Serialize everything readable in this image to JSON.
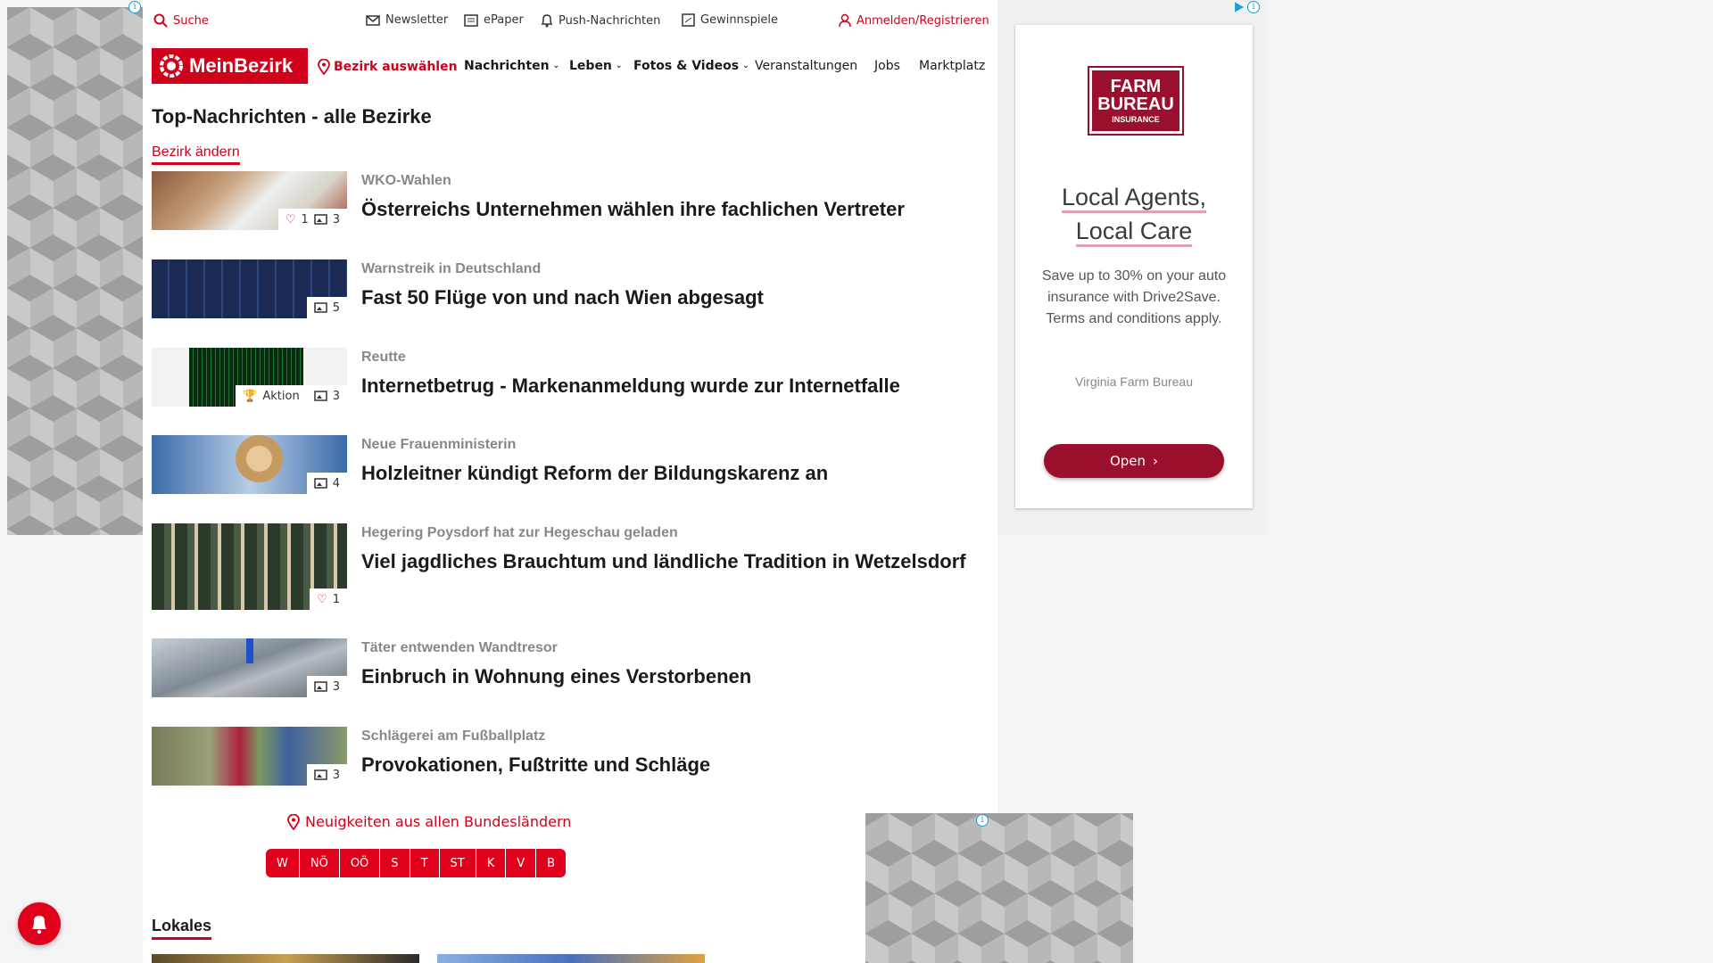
{
  "utility_bar": {
    "search": "Suche",
    "newsletter": "Newsletter",
    "epaper": "ePaper",
    "push": "Push-Nachrichten",
    "gewinnspiele": "Gewinnspiele",
    "login": "Anmelden/Registrieren"
  },
  "nav": {
    "logo": "MeinBezirk",
    "bezirk_auswaehlen": "Bezirk auswählen",
    "links": [
      "Nachrichten",
      "Leben",
      "Fotos & Videos",
      "Veranstaltungen",
      "Jobs",
      "Marktplatz"
    ]
  },
  "page": {
    "title": "Top-Nachrichten - alle Bezirke",
    "bezirk_aendern": "Bezirk ändern"
  },
  "articles": [
    {
      "kicker": "WKO-Wahlen",
      "headline": "Österreichs Unternehmen wählen ihre fachlichen Vertreter",
      "likes": "1",
      "images": "3"
    },
    {
      "kicker": "Warnstreik in Deutschland",
      "headline": "Fast 50 Flüge von und nach Wien abgesagt",
      "images": "5"
    },
    {
      "kicker": "Reutte",
      "headline": "Internetbetrug - Markenanmeldung wurde zur Internetfalle",
      "tag": "Aktion",
      "images": "3"
    },
    {
      "kicker": "Neue Frauenministerin",
      "headline": "Holzleitner kündigt Reform der Bildungskarenz an",
      "images": "4"
    },
    {
      "kicker": "Hegering Poysdorf hat zur Hegeschau geladen",
      "headline": "Viel jagdliches Brauchtum und ländliche Tradition in Wetzelsdorf",
      "likes": "1"
    },
    {
      "kicker": "Täter entwenden Wandtresor",
      "headline": "Einbruch in Wohnung eines Verstorbenen",
      "images": "3"
    },
    {
      "kicker": "Schlägerei am Fußballplatz",
      "headline": "Provokationen, Fußtritte und Schläge",
      "images": "3"
    }
  ],
  "bundeslaender": {
    "label": "Neuigkeiten aus allen Bundesländern",
    "states": [
      "W",
      "NÖ",
      "OÖ",
      "S",
      "T",
      "ST",
      "K",
      "V",
      "B"
    ]
  },
  "lokales": "Lokales",
  "ad": {
    "brand_line1": "FARM",
    "brand_line2": "BUREAU",
    "brand_line3": "INSURANCE",
    "headline_line1": "Local Agents,",
    "headline_line2": "Local Care",
    "body": "Save up to 30% on your auto insurance with Drive2Save. Terms and conditions apply.",
    "advertiser": "Virginia Farm Bureau",
    "cta": "Open"
  },
  "colors": {
    "brand_red": "#d0021b",
    "ad_maroon": "#9a0f2e"
  }
}
